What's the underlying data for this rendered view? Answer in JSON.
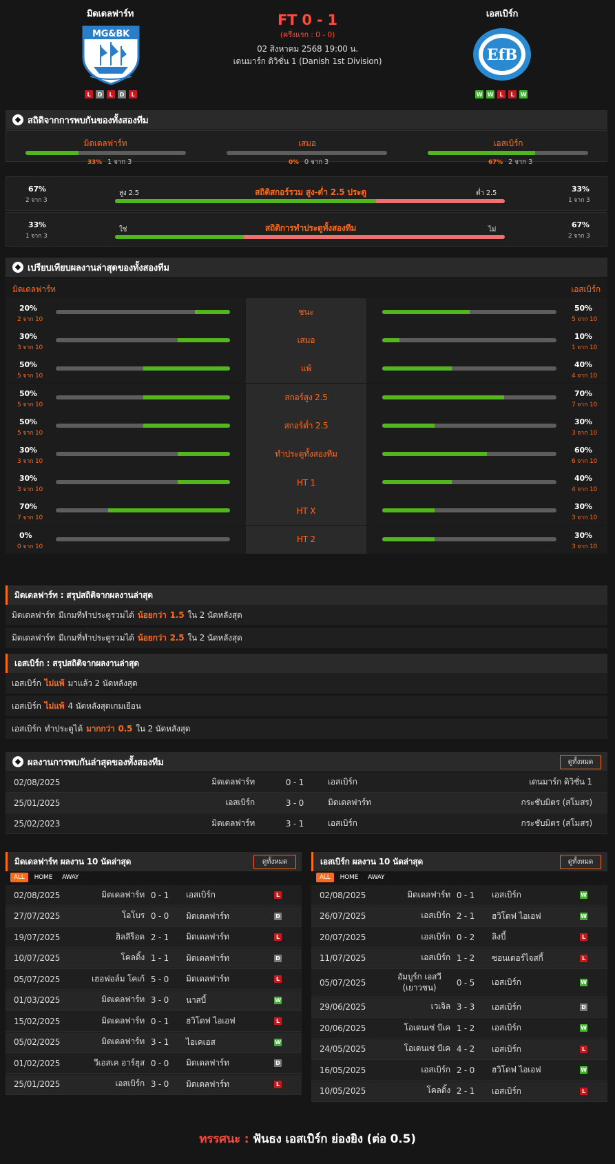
{
  "match": {
    "home": "มิดเดลฟาร์ท",
    "away": "เอสเบิร์ก",
    "score": "FT 0 - 1",
    "halftime": "(ครึ่งแรก : 0 - 0)",
    "date": "02 สิงหาคม 2568 19:00 น.",
    "league": "เดนมาร์ก ดิวิชั่น 1 (Danish 1st Division)",
    "home_logo_text": "MG&BK",
    "away_logo_text": "EfB",
    "home_form": [
      "L",
      "D",
      "L",
      "D",
      "L"
    ],
    "away_form": [
      "W",
      "W",
      "L",
      "L",
      "W"
    ]
  },
  "h2h_stats": {
    "title": "สถิติจากการพบกันของทั้งสองทีม",
    "cols": [
      {
        "label": "มิดเดลฟาร์ท",
        "pct": "33%",
        "sub": "1 จาก 3",
        "fill": 33
      },
      {
        "label": "เสมอ",
        "pct": "0%",
        "sub": "0 จาก 3",
        "fill": 0
      },
      {
        "label": "เอสเบิร์ก",
        "pct": "67%",
        "sub": "2 จาก 3",
        "fill": 67
      }
    ],
    "ou": {
      "left_pct": "67%",
      "left_sub": "2 จาก 3",
      "left_label": "สูง 2.5",
      "title": "สถิติสกอร์รวม สูง-ต่ำ 2.5 ประตู",
      "right_label": "ต่ำ 2.5",
      "right_pct": "33%",
      "right_sub": "1 จาก 3",
      "fill": 67
    },
    "btts": {
      "left_pct": "33%",
      "left_sub": "1 จาก 3",
      "left_label": "ใช่",
      "title": "สถิติการทำประตูทั้งสองทีม",
      "right_label": "ไม่",
      "right_pct": "67%",
      "right_sub": "2 จาก 3",
      "fill": 33
    }
  },
  "compare": {
    "title": "เปรียบเทียบผลงานล่าสุดของทั้งสองทีม",
    "home": "มิดเดลฟาร์ท",
    "away": "เอสเบิร์ก",
    "rows": [
      {
        "label": "ชนะ",
        "hp": "20%",
        "hs": "2 จาก 10",
        "hv": 20,
        "ap": "50%",
        "as": "5 จาก 10",
        "av": 50
      },
      {
        "label": "เสมอ",
        "hp": "30%",
        "hs": "3 จาก 10",
        "hv": 30,
        "ap": "10%",
        "as": "1 จาก 10",
        "av": 10
      },
      {
        "label": "แพ้",
        "hp": "50%",
        "hs": "5 จาก 10",
        "hv": 50,
        "ap": "40%",
        "as": "4 จาก 10",
        "av": 40
      },
      {
        "label": "สกอร์สูง 2.5",
        "hp": "50%",
        "hs": "5 จาก 10",
        "hv": 50,
        "ap": "70%",
        "as": "7 จาก 10",
        "av": 70
      },
      {
        "label": "สกอร์ต่ำ 2.5",
        "hp": "50%",
        "hs": "5 จาก 10",
        "hv": 50,
        "ap": "30%",
        "as": "3 จาก 10",
        "av": 30
      },
      {
        "label": "ทำประตูทั้งสองทีม",
        "hp": "30%",
        "hs": "3 จาก 10",
        "hv": 30,
        "ap": "60%",
        "as": "6 จาก 10",
        "av": 60
      },
      {
        "label": "HT 1",
        "hp": "30%",
        "hs": "3 จาก 10",
        "hv": 30,
        "ap": "40%",
        "as": "4 จาก 10",
        "av": 40
      },
      {
        "label": "HT X",
        "hp": "70%",
        "hs": "7 จาก 10",
        "hv": 70,
        "ap": "30%",
        "as": "3 จาก 10",
        "av": 30
      },
      {
        "label": "HT 2",
        "hp": "0%",
        "hs": "0 จาก 10",
        "hv": 0,
        "ap": "30%",
        "as": "3 จาก 10",
        "av": 30
      }
    ]
  },
  "home_summary": {
    "title": "มิดเดลฟาร์ท : สรุปสถิติจากผลงานล่าสุด",
    "lines": [
      {
        "a": "มิดเดลฟาร์ท",
        "b": "มีเกมที่ทำประตูรวมได้",
        "c": "น้อยกว่า",
        "d": "1.5",
        "e": "ใน 2 นัดหลังสุด"
      },
      {
        "a": "มิดเดลฟาร์ท",
        "b": "มีเกมที่ทำประตูรวมได้",
        "c": "น้อยกว่า",
        "d": "2.5",
        "e": "ใน 2 นัดหลังสุด"
      }
    ]
  },
  "away_summary": {
    "title": "เอสเบิร์ก : สรุปสถิติจากผลงานล่าสุด",
    "lines": [
      {
        "a": "เอสเบิร์ก",
        "b": "",
        "c": "ไม่แพ้",
        "d": "",
        "e": "มาแล้ว 2 นัดหลังสุด"
      },
      {
        "a": "เอสเบิร์ก",
        "b": "",
        "c": "ไม่แพ้",
        "d": "",
        "e": "4  นัดหลังสุดเกมเยือน"
      },
      {
        "a": "เอสเบิร์ก",
        "b": "ทำประตูได้",
        "c": "มากกว่า",
        "d": "0.5",
        "e": "ใน 2 นัดหลังสุด"
      }
    ]
  },
  "h2h": {
    "title": "ผลงานการพบกันล่าสุดของทั้งสองทีม",
    "view_all": "ดูทั้งหมด",
    "rows": [
      {
        "date": "02/08/2025",
        "home": "มิดเดลฟาร์ท",
        "score": "0 - 1",
        "away": "เอสเบิร์ก",
        "comp": "เดนมาร์ก ดิวิชั่น 1"
      },
      {
        "date": "25/01/2025",
        "home": "เอสเบิร์ก",
        "score": "3 - 0",
        "away": "มิดเดลฟาร์ท",
        "comp": "กระชับมิตร (สโมสร)"
      },
      {
        "date": "25/02/2023",
        "home": "มิดเดลฟาร์ท",
        "score": "3 - 1",
        "away": "เอสเบิร์ก",
        "comp": "กระชับมิตร (สโมสร)"
      }
    ]
  },
  "tabs": [
    "ALL",
    "HOME",
    "AWAY"
  ],
  "home_last10": {
    "title": "มิดเดลฟาร์ท ผลงาน 10 นัดล่าสุด",
    "view_all": "ดูทั้งหมด",
    "rows": [
      {
        "date": "02/08/2025",
        "home": "มิดเดลฟาร์ท",
        "score": "0 - 1",
        "away": "เอสเบิร์ก",
        "res": "L"
      },
      {
        "date": "27/07/2025",
        "home": "โอโบร",
        "score": "0 - 0",
        "away": "มิดเดลฟาร์ท",
        "res": "D"
      },
      {
        "date": "19/07/2025",
        "home": "ฮิลลีร็อด",
        "score": "2 - 1",
        "away": "มิดเดลฟาร์ท",
        "res": "L"
      },
      {
        "date": "10/07/2025",
        "home": "โคลดิ้ง",
        "score": "1 - 1",
        "away": "มิดเดลฟาร์ท",
        "res": "D"
      },
      {
        "date": "05/07/2025",
        "home": "เฮอฟอล์ม โคเก้",
        "score": "5 - 0",
        "away": "มิดเดลฟาร์ท",
        "res": "L"
      },
      {
        "date": "01/03/2025",
        "home": "มิดเดลฟาร์ท",
        "score": "3 - 0",
        "away": "นาสบี้",
        "res": "W"
      },
      {
        "date": "15/02/2025",
        "home": "มิดเดลฟาร์ท",
        "score": "0 - 1",
        "away": "ฮวิโดฟ ไอเอฟ",
        "res": "L"
      },
      {
        "date": "05/02/2025",
        "home": "มิดเดลฟาร์ท",
        "score": "3 - 1",
        "away": "ไอเคเอส",
        "res": "W"
      },
      {
        "date": "01/02/2025",
        "home": "วีเอสเค อาร์ฮุส",
        "score": "0 - 0",
        "away": "มิดเดลฟาร์ท",
        "res": "D"
      },
      {
        "date": "25/01/2025",
        "home": "เอสเบิร์ก",
        "score": "3 - 0",
        "away": "มิดเดลฟาร์ท",
        "res": "L"
      }
    ]
  },
  "away_last10": {
    "title": "เอสเบิร์ก ผลงาน 10 นัดล่าสุด",
    "view_all": "ดูทั้งหมด",
    "rows": [
      {
        "date": "02/08/2025",
        "home": "มิดเดลฟาร์ท",
        "score": "0 - 1",
        "away": "เอสเบิร์ก",
        "res": "W"
      },
      {
        "date": "26/07/2025",
        "home": "เอสเบิร์ก",
        "score": "2 - 1",
        "away": "ฮวิโดฟ ไอเอฟ",
        "res": "W"
      },
      {
        "date": "20/07/2025",
        "home": "เอสเบิร์ก",
        "score": "0 - 2",
        "away": "ลิงบี้",
        "res": "L"
      },
      {
        "date": "11/07/2025",
        "home": "เอสเบิร์ก",
        "score": "1 - 2",
        "away": "ซอนเดอร์ไจสกี้",
        "res": "L"
      },
      {
        "date": "05/07/2025",
        "home": "อัมบูร์ก เอสวี (เยาวชน)",
        "score": "0 - 5",
        "away": "เอสเบิร์ก",
        "res": "W"
      },
      {
        "date": "29/06/2025",
        "home": "เวเจิล",
        "score": "3 - 3",
        "away": "เอสเบิร์ก",
        "res": "D"
      },
      {
        "date": "20/06/2025",
        "home": "โอเดนเซ่ บีเค",
        "score": "1 - 2",
        "away": "เอสเบิร์ก",
        "res": "W"
      },
      {
        "date": "24/05/2025",
        "home": "โอเดนเซ่ บีเค",
        "score": "4 - 2",
        "away": "เอสเบิร์ก",
        "res": "L"
      },
      {
        "date": "16/05/2025",
        "home": "เอสเบิร์ก",
        "score": "2 - 0",
        "away": "ฮวิโดฟ ไอเอฟ",
        "res": "W"
      },
      {
        "date": "10/05/2025",
        "home": "โคลดิ้ง",
        "score": "2 - 1",
        "away": "เอสเบิร์ก",
        "res": "L"
      }
    ]
  },
  "prediction": {
    "label": "ทรรศนะ :",
    "text": "ฟันธง เอสเบิร์ก ย่องยิง (ต่อ 0.5)"
  },
  "colors": {
    "accent": "#ff6a1a",
    "win": "#3eb52b",
    "loss": "#c8181e",
    "draw": "#7a7a7a",
    "bar_green": "#52b61f",
    "bar_red": "#f07070"
  }
}
